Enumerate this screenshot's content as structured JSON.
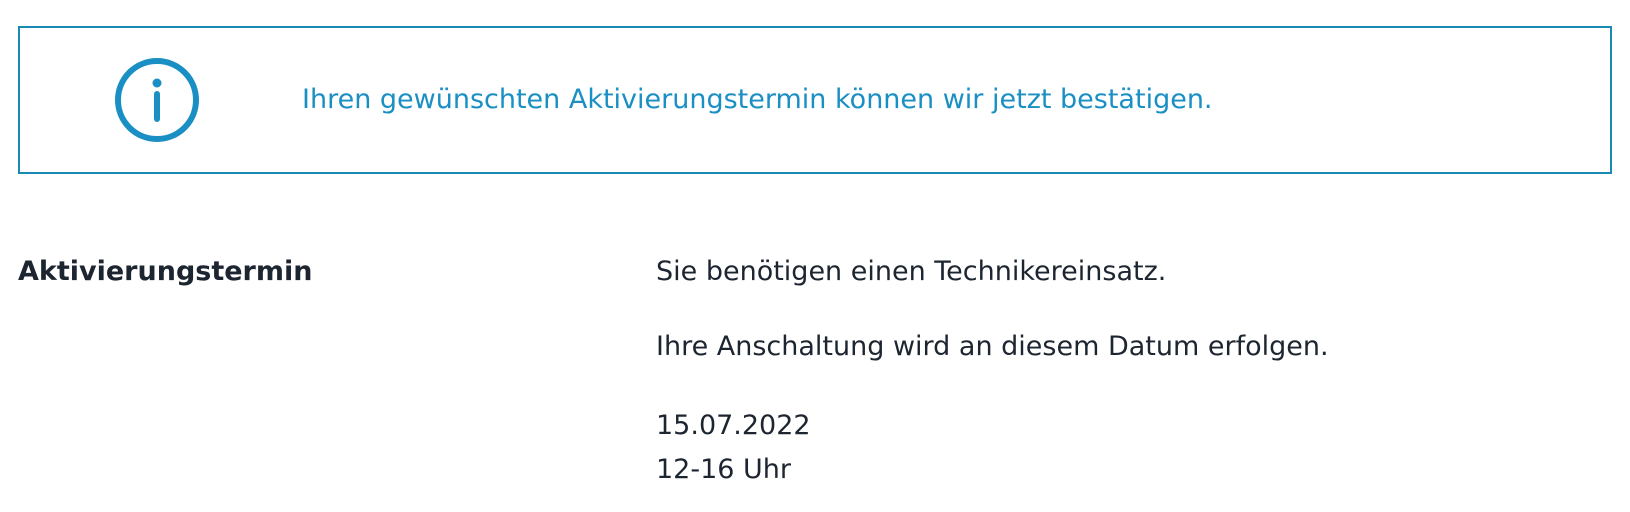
{
  "info_banner": {
    "icon": "info-icon",
    "message": "Ihren gewünschten Aktivierungstermin können wir jetzt bestätigen.",
    "accent_color": "#1a8fc4",
    "border_color": "#1b8ab3"
  },
  "activation": {
    "label": "Aktivierungstermin",
    "technician_text": "Sie benötigen einen Technikereinsatz.",
    "connection_text": "Ihre Anschaltung wird an diesem Datum erfolgen.",
    "date": "15.07.2022",
    "time": "12-16 Uhr"
  }
}
